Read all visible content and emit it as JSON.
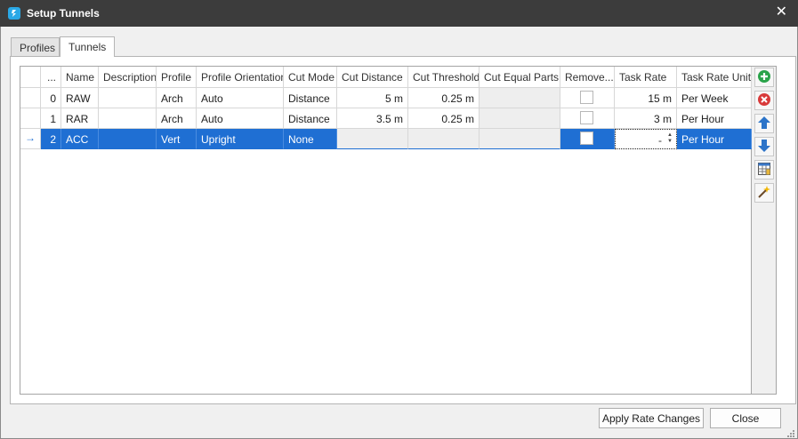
{
  "window": {
    "title": "Setup Tunnels",
    "close_glyph": "✕"
  },
  "tabs": [
    {
      "label": "Profiles"
    },
    {
      "label": "Tunnels"
    }
  ],
  "grid": {
    "columns": [
      "...",
      "Name",
      "Description",
      "Profile",
      "Profile Orientation",
      "Cut Mode",
      "Cut Distance",
      "Cut Threshold",
      "Cut Equal Parts",
      "Remove...",
      "Task Rate",
      "Task Rate Unit"
    ],
    "rows": [
      {
        "index": "0",
        "name": "RAW",
        "description": "",
        "profile": "Arch",
        "orientation": "Auto",
        "cut_mode": "Distance",
        "cut_distance": "5 m",
        "cut_threshold": "0.25 m",
        "cut_equal_parts": "",
        "remove": false,
        "task_rate": "15 m",
        "task_rate_unit": "Per Week"
      },
      {
        "index": "1",
        "name": "RAR",
        "description": "",
        "profile": "Arch",
        "orientation": "Auto",
        "cut_mode": "Distance",
        "cut_distance": "3.5 m",
        "cut_threshold": "0.25 m",
        "cut_equal_parts": "",
        "remove": false,
        "task_rate": "3 m",
        "task_rate_unit": "Per Hour"
      },
      {
        "index": "2",
        "name": "ACC",
        "description": "",
        "profile": "Vert",
        "orientation": "Upright",
        "cut_mode": "None",
        "cut_distance": "",
        "cut_threshold": "",
        "cut_equal_parts": "",
        "remove": false,
        "task_rate": "-",
        "task_rate_unit": "Per Hour"
      }
    ],
    "selected_row_indicator": "→"
  },
  "sidebar_icons": [
    "add-icon",
    "delete-icon",
    "move-up-icon",
    "move-down-icon",
    "table-grid-icon",
    "wand-icon"
  ],
  "footer": {
    "apply_label": "Apply Rate Changes",
    "close_label": "Close"
  },
  "colors": {
    "titlebar": "#3c3c3c",
    "selection": "#1f6fd3",
    "add_green": "#2aa34a",
    "delete_red": "#d83a3a",
    "arrow_blue": "#2c74c9"
  }
}
